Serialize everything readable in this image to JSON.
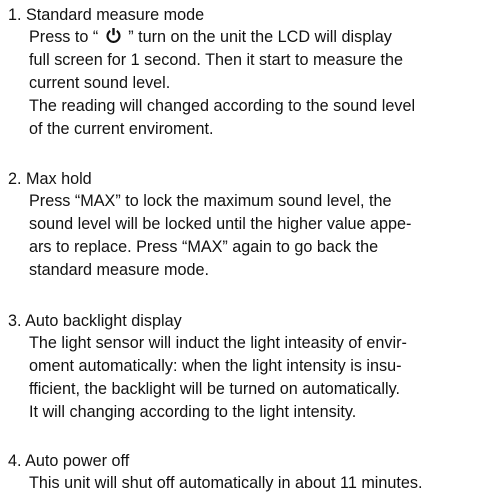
{
  "icons": {
    "power": "power-icon"
  },
  "sections": [
    {
      "heading": "1. Standard measure mode",
      "lines": [
        {
          "pre": "Press to “ ",
          "has_icon": true,
          "post": " ”  turn on the unit the LCD will display"
        },
        {
          "text": "full screen for 1 second. Then it start to measure the"
        },
        {
          "text": "current sound level."
        },
        {
          "text": "The reading will changed according to the sound level"
        },
        {
          "text": "of the current enviroment."
        }
      ]
    },
    {
      "heading": "2. Max hold",
      "lines": [
        {
          "text": "Press “MAX”  to lock the maximum sound level, the"
        },
        {
          "text": "sound level will be locked until the higher value appe-"
        },
        {
          "text": "ars to replace. Press “MAX”  again to go back the"
        },
        {
          "text": "standard measure mode."
        }
      ]
    },
    {
      "heading": "3. Auto backlight display",
      "lines": [
        {
          "text": "The light sensor will induct the light inteasity of envir-"
        },
        {
          "text": "oment automatically: when the light intensity is insu-"
        },
        {
          "text": "fficient, the backlight will be turned on automatically."
        },
        {
          "text": "It will changing according to the light intensity."
        }
      ]
    },
    {
      "heading": "4. Auto power off",
      "lines": [
        {
          "text": "This unit will shut off automatically in about 11 minutes."
        }
      ]
    }
  ]
}
